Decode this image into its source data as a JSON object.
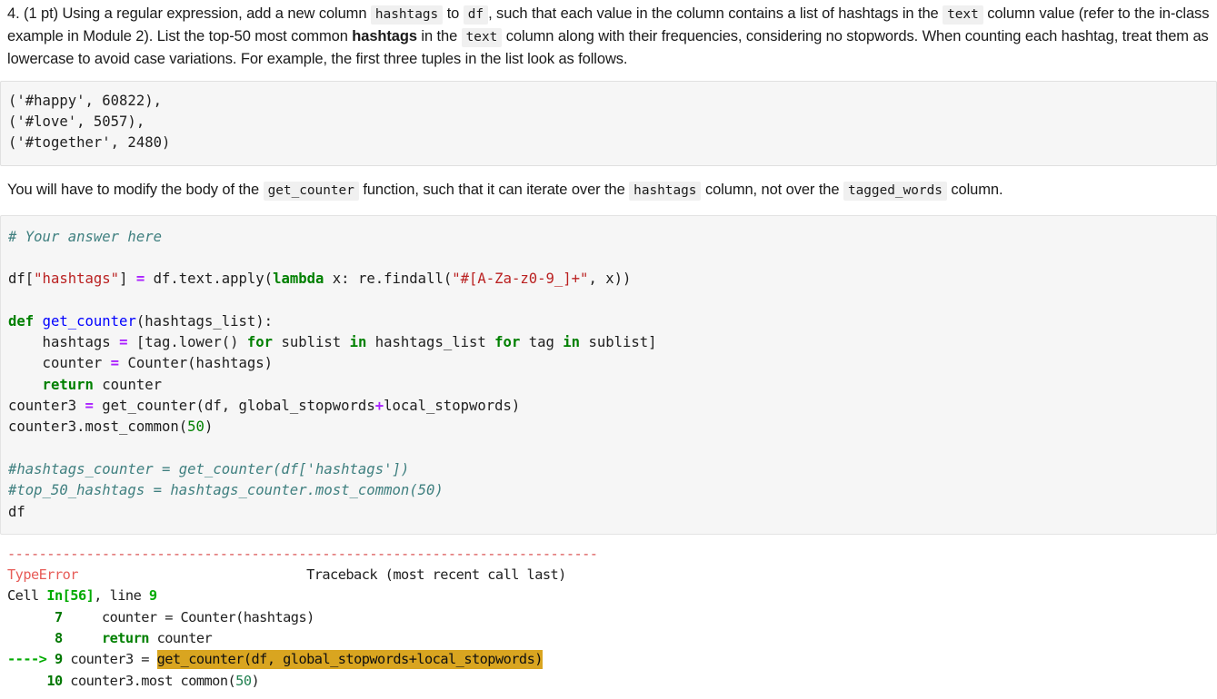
{
  "question": {
    "number": "4.",
    "points": "(1 pt)",
    "part1": "Using a regular expression, add a new column",
    "chip_hashtags": "hashtags",
    "word_to": "to",
    "chip_df": "df",
    "part2": ", such that each value in the column contains a list of hashtags in the",
    "chip_text1": "text",
    "part3": "column value (refer to the in-class example in Module 2). List the top-50 most common",
    "bold_hashtags": "hashtags",
    "word_in_the": "in the",
    "chip_text2": "text",
    "part4": "column along with their frequencies, considering no stopwords. When counting each hashtag, treat them as lowercase to avoid case variations. For example, the first three tuples in the list look as follows."
  },
  "example_output": {
    "lines": [
      "('#happy', 60822),",
      "('#love', 5057),",
      "('#together', 2480)"
    ]
  },
  "hint": {
    "part1": "You will have to modify the body of the",
    "chip_get_counter": "get_counter",
    "part2": "function, such that it can iterate over the",
    "chip_hashtags": "hashtags",
    "part3": "column, not over the",
    "chip_tagged_words": "tagged_words",
    "part4": "column."
  },
  "code_cell": {
    "comment_header": "# Your answer here",
    "line_assign_prefix": "df[",
    "line_assign_string": "\"hashtags\"",
    "line_assign_mid": "] ",
    "line_assign_eq": "=",
    "line_assign_rest": " df.text.apply(",
    "kw_lambda": "lambda",
    "line_lambda_rest": " x: re.findall(",
    "regex_string": "\"#[A-Za-z0-9_]+\"",
    "line_assign_tail": ", x))",
    "kw_def": "def",
    "func_name": "get_counter",
    "def_args": "(hashtags_list):",
    "body1_a": "    hashtags ",
    "body1_op": "=",
    "body1_b": " [tag.lower() ",
    "body1_for1": "for",
    "body1_c": " sublist ",
    "body1_in1": "in",
    "body1_d": " hashtags_list ",
    "body1_for2": "for",
    "body1_e": " tag ",
    "body1_in2": "in",
    "body1_f": " sublist]",
    "body2_a": "    counter ",
    "body2_op": "=",
    "body2_b": " Counter(hashtags)",
    "body3_kw": "    return",
    "body3_b": " counter",
    "call_a": "counter3 ",
    "call_op": "=",
    "call_b": " get_counter(df, global_stopwords",
    "call_plus": "+",
    "call_c": "local_stopwords)",
    "most_common_a": "counter3.most_common(",
    "most_common_num": "50",
    "most_common_b": ")",
    "commented_1": "#hashtags_counter = get_counter(df['hashtags'])",
    "commented_2": "#top_50_hashtags = hashtags_counter.most_common(50)",
    "df_line": "df"
  },
  "traceback": {
    "rule": "---------------------------------------------------------------------------",
    "error_name": "TypeError",
    "header_right": "Traceback (most recent call last)",
    "cell_word": "Cell ",
    "cell_ref": "In[56]",
    "cell_mid": ", line ",
    "cell_line": "9",
    "rows": [
      {
        "marker": "",
        "lineno": "7",
        "indent": "    ",
        "code": "counter = Counter(hashtags)",
        "highlight": ""
      },
      {
        "marker": "",
        "lineno": "8",
        "indent": "    ",
        "code": "return counter",
        "highlight": ""
      },
      {
        "marker": "---->",
        "lineno": "9",
        "indent": "",
        "code": "counter3 = ",
        "highlight": "get_counter(df, global_stopwords+local_stopwords)"
      },
      {
        "marker": "",
        "lineno": "10",
        "indent": "",
        "code": "counter3.most common(50)",
        "highlight": ""
      }
    ]
  },
  "colors": {
    "highlight": "#d9a520",
    "error": "#e75c58",
    "keyword_green": "#008000",
    "string_red": "#ba2121",
    "comment_teal": "#408080",
    "operator_purple": "#aa22ff",
    "func_blue": "#0000ff",
    "chip_bg": "#f0f0f0",
    "cell_bg": "#f6f6f6"
  }
}
